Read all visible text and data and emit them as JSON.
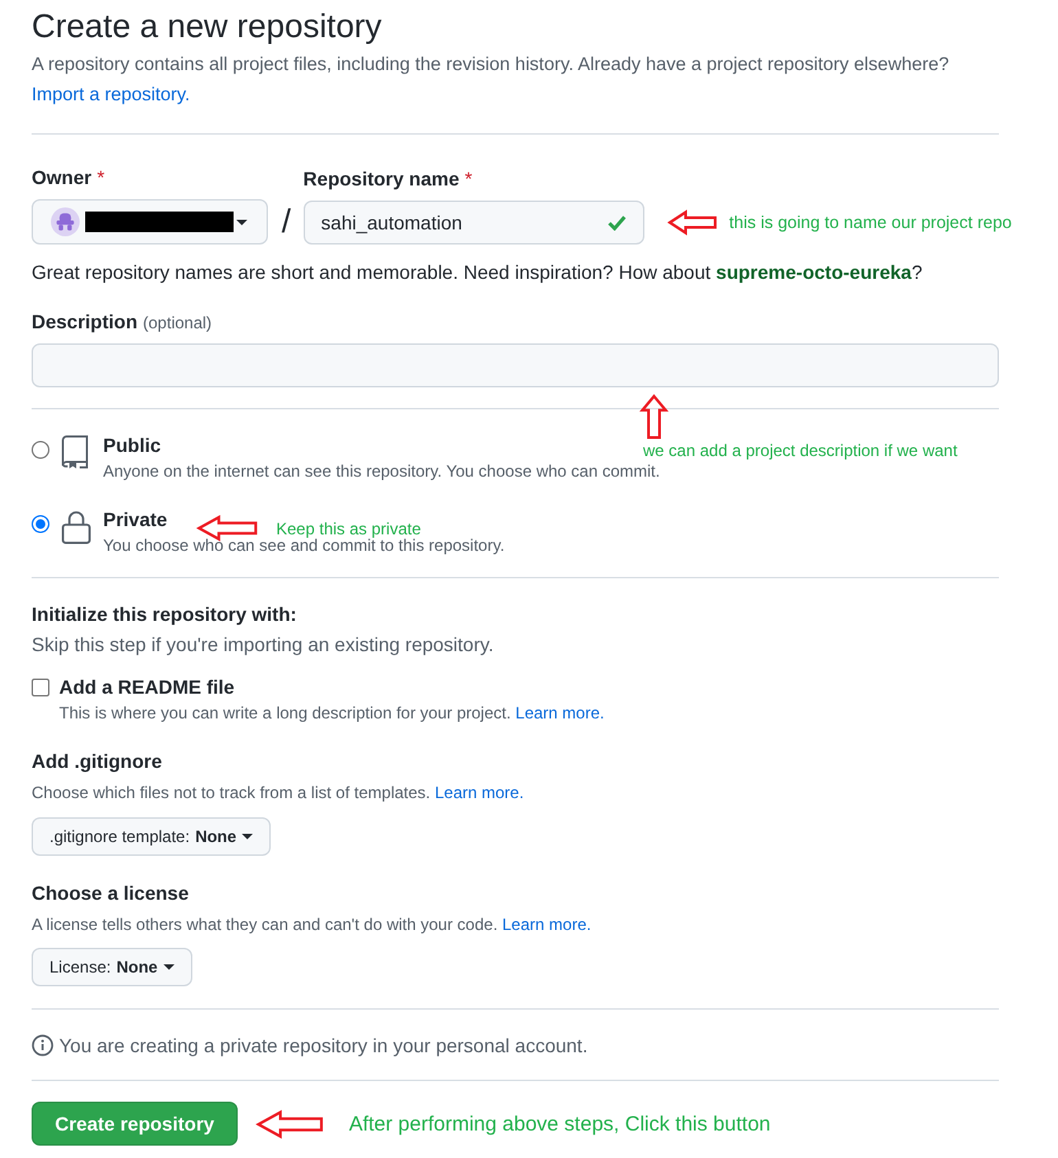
{
  "page": {
    "title": "Create a new repository",
    "intro": "A repository contains all project files, including the revision history. Already have a project repository elsewhere?",
    "import_link": "Import a repository."
  },
  "owner": {
    "label": "Owner",
    "required_mark": "*",
    "redacted": true
  },
  "separator": "/",
  "repository_name": {
    "label": "Repository name",
    "required_mark": "*",
    "value": "sahi_automation",
    "valid": true,
    "annotation": {
      "kind": "left",
      "text": "this is going to name our project repo"
    }
  },
  "name_hint": "Great repository names are short and memorable. Need inspiration? How about **supreme-octo-eureka**?",
  "description": {
    "label": "Description",
    "note": "(optional)",
    "annotation": {
      "kind": "up",
      "text": "we can add a project description if we want"
    }
  },
  "visibility": [
    {
      "kind": "public",
      "label": "Public",
      "description": "Anyone on the internet can see this repository. You choose who can commit.",
      "selected": false
    },
    {
      "kind": "private",
      "label": "Private",
      "description": "You choose who can see and commit to this repository.",
      "selected": true,
      "annotation": {
        "kind": "left",
        "text": "Keep this as private"
      }
    }
  ],
  "initialize": {
    "title": "Initialize this repository with:",
    "subtitle": "Skip this step if you're importing an existing repository.",
    "readme": {
      "label": "Add a README file",
      "checked": false,
      "description": "This is where you can write a long description for your project.",
      "link": "Learn more."
    }
  },
  "gitignore": {
    "title": "Add .gitignore",
    "description": "Choose which files not to track from a list of templates.",
    "link": "Learn more.",
    "select": {
      "prefix": ".gitignore template:",
      "value": "None"
    }
  },
  "license": {
    "title": "Choose a license",
    "description": "A license tells others what they can and can't do with your code.",
    "link": "Learn more.",
    "select": {
      "prefix": "License:",
      "value": "None"
    }
  },
  "notice": "You are creating a private repository in your personal account.",
  "submit": {
    "label": "Create repository",
    "annotation": {
      "kind": "left",
      "text": "After performing above steps, Click this button"
    }
  }
}
